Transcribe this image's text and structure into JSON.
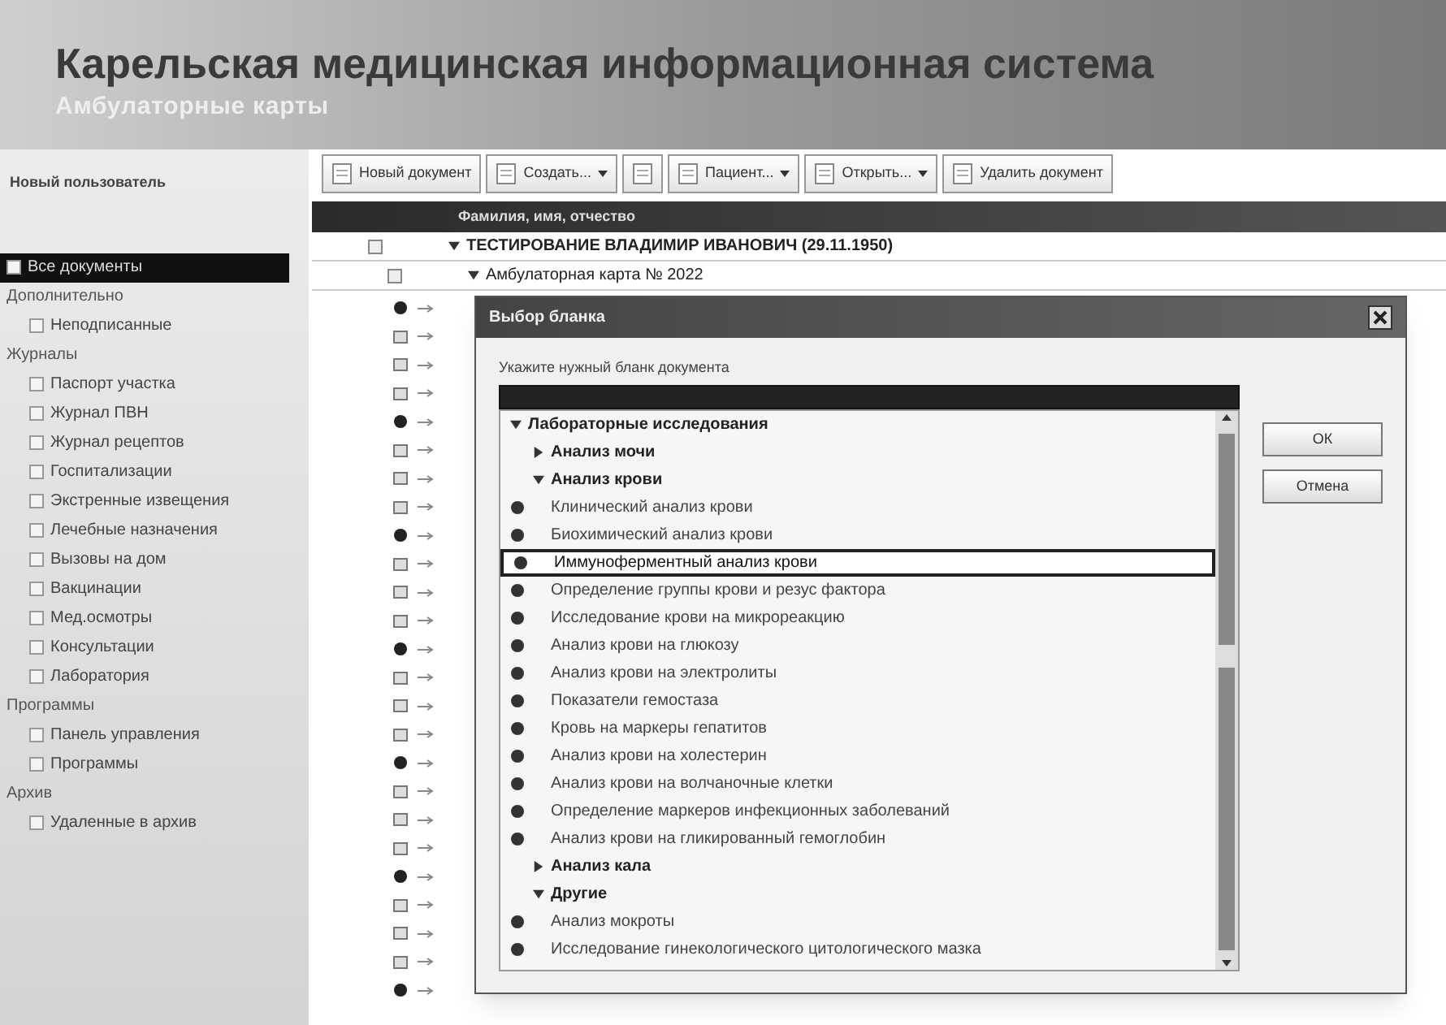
{
  "header": {
    "title": "Карельская медицинская информационная система",
    "subtitle": "Амбулаторные карты"
  },
  "sidebar": {
    "user": "Новый пользователь",
    "items": [
      {
        "kind": "item",
        "label": "Все документы",
        "selected": true
      },
      {
        "kind": "header",
        "label": "Дополнительно"
      },
      {
        "kind": "item",
        "label": "Неподписанные",
        "selected": false
      },
      {
        "kind": "header",
        "label": "Журналы"
      },
      {
        "kind": "item",
        "label": "Паспорт участка",
        "selected": false
      },
      {
        "kind": "item",
        "label": "Журнал ПВН",
        "selected": false
      },
      {
        "kind": "item",
        "label": "Журнал рецептов",
        "selected": false
      },
      {
        "kind": "item",
        "label": "Госпитализации",
        "selected": false
      },
      {
        "kind": "item",
        "label": "Экстренные извещения",
        "selected": false
      },
      {
        "kind": "item",
        "label": "Лечебные назначения",
        "selected": false
      },
      {
        "kind": "item",
        "label": "Вызовы на дом",
        "selected": false
      },
      {
        "kind": "item",
        "label": "Вакцинации",
        "selected": false
      },
      {
        "kind": "item",
        "label": "Мед.осмотры",
        "selected": false
      },
      {
        "kind": "item",
        "label": "Консультации",
        "selected": false
      },
      {
        "kind": "item",
        "label": "Лаборатория",
        "selected": false
      },
      {
        "kind": "header",
        "label": "Программы"
      },
      {
        "kind": "item",
        "label": "Панель управления",
        "selected": false
      },
      {
        "kind": "item",
        "label": "Программы",
        "selected": false
      },
      {
        "kind": "header",
        "label": "Архив"
      },
      {
        "kind": "item",
        "label": "Удаленные в архив",
        "selected": false
      }
    ]
  },
  "toolbar": [
    {
      "label": "Новый документ",
      "dropdown": false
    },
    {
      "label": "Создать...",
      "dropdown": true
    },
    {
      "dropdown": false
    },
    {
      "label": "Пациент...",
      "dropdown": true
    },
    {
      "label": "Открыть...",
      "dropdown": true
    },
    {
      "label": "Удалить документ",
      "dropdown": false
    }
  ],
  "table": {
    "column": "Фамилия, имя, отчество",
    "rows": [
      {
        "label": "ТЕСТИРОВАНИЕ ВЛАДИМИР ИВАНОВИЧ (29.11.1950)",
        "bold": true
      },
      {
        "label": "Амбулаторная карта № 2022",
        "bold": false
      }
    ]
  },
  "dialog": {
    "title": "Выбор бланка",
    "prompt": "Укажите нужный бланк документа",
    "buttons": [
      "ОК",
      "Отмена"
    ],
    "tree": [
      {
        "kind": "group",
        "label": "Лабораторные исследования",
        "expanded": true,
        "children": [
          {
            "kind": "group",
            "label": "Анализ мочи",
            "expanded": false
          },
          {
            "kind": "group",
            "label": "Анализ крови",
            "expanded": true,
            "children": [
              {
                "kind": "item",
                "label": "Клинический анализ крови",
                "selected": false
              },
              {
                "kind": "item",
                "label": "Биохимический анализ крови",
                "selected": false
              },
              {
                "kind": "item",
                "label": "Иммуноферментный анализ крови",
                "selected": true
              },
              {
                "kind": "item",
                "label": "Определение группы крови и резус фактора",
                "selected": false
              },
              {
                "kind": "item",
                "label": "Исследование крови на микрореакцию",
                "selected": false
              },
              {
                "kind": "item",
                "label": "Анализ крови на глюкозу",
                "selected": false
              },
              {
                "kind": "item",
                "label": "Анализ крови на электролиты",
                "selected": false
              },
              {
                "kind": "item",
                "label": "Показатели гемостаза",
                "selected": false
              },
              {
                "kind": "item",
                "label": "Кровь на маркеры гепатитов",
                "selected": false
              },
              {
                "kind": "item",
                "label": "Анализ крови на холестерин",
                "selected": false
              },
              {
                "kind": "item",
                "label": "Анализ крови на волчаночные клетки",
                "selected": false
              },
              {
                "kind": "item",
                "label": "Определение маркеров инфекционных заболеваний",
                "selected": false
              },
              {
                "kind": "item",
                "label": "Анализ крови на гликированный гемоглобин",
                "selected": false
              }
            ]
          },
          {
            "kind": "group",
            "label": "Анализ кала",
            "expanded": false
          },
          {
            "kind": "group",
            "label": "Другие",
            "expanded": true,
            "children": [
              {
                "kind": "item",
                "label": "Анализ мокроты",
                "selected": false
              },
              {
                "kind": "item",
                "label": "Исследование гинекологического цитологического мазка",
                "selected": false
              }
            ]
          }
        ]
      }
    ]
  }
}
